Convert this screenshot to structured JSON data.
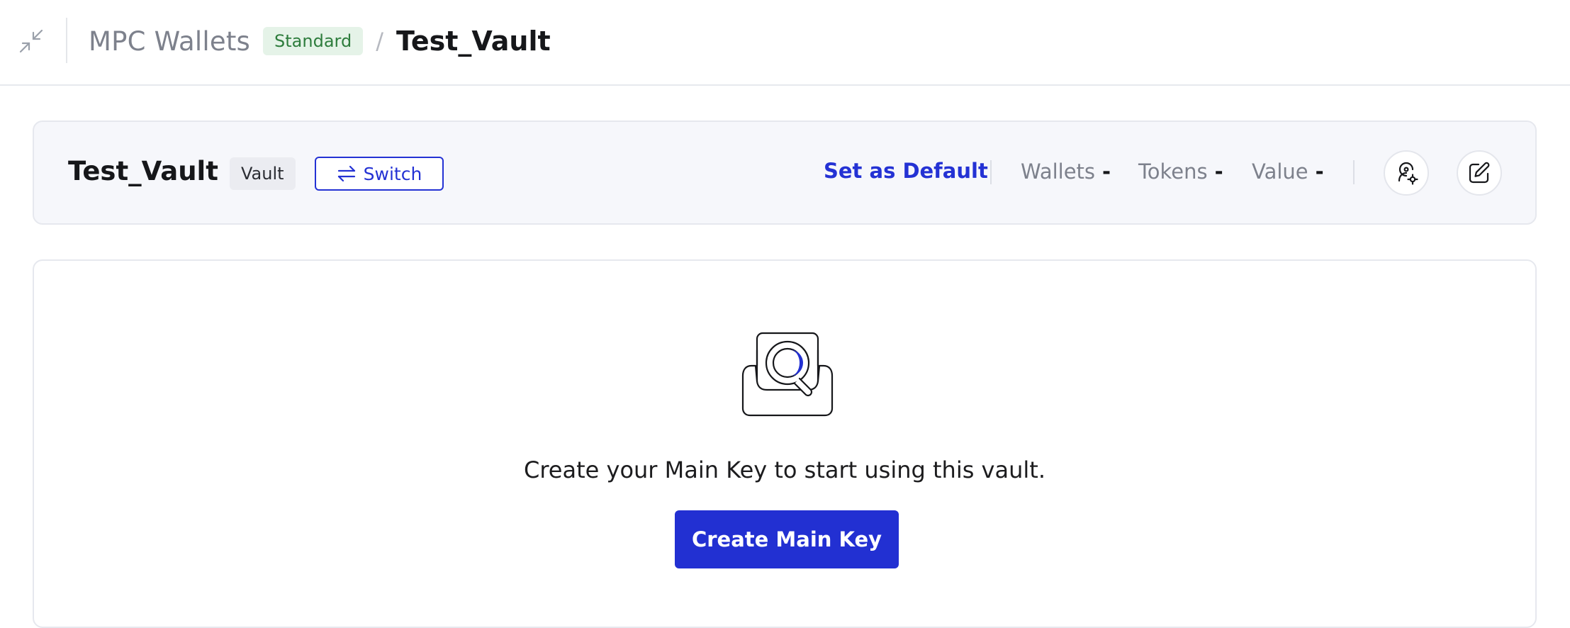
{
  "header": {
    "collapse_icon": "collapse-arrows-icon",
    "breadcrumb_root": "MPC Wallets",
    "plan_badge": "Standard",
    "separator": "/",
    "current": "Test_Vault"
  },
  "vault": {
    "name": "Test_Vault",
    "type_chip": "Vault",
    "switch_label": "Switch",
    "switch_icon": "swap-arrows-icon",
    "set_default_label": "Set as Default",
    "stats": [
      {
        "label": "Wallets",
        "value": "-"
      },
      {
        "label": "Tokens",
        "value": "-"
      },
      {
        "label": "Value",
        "value": "-"
      }
    ],
    "actions": [
      {
        "icon": "user-settings-icon"
      },
      {
        "icon": "edit-icon"
      }
    ]
  },
  "empty_state": {
    "illustration": "inbox-search-icon",
    "message": "Create your Main Key to start using this vault.",
    "button_label": "Create Main Key"
  },
  "colors": {
    "accent": "#2432d4",
    "badge_bg": "#e5f3e8",
    "badge_text": "#2e7d3d",
    "card_bg": "#f6f7fb"
  }
}
